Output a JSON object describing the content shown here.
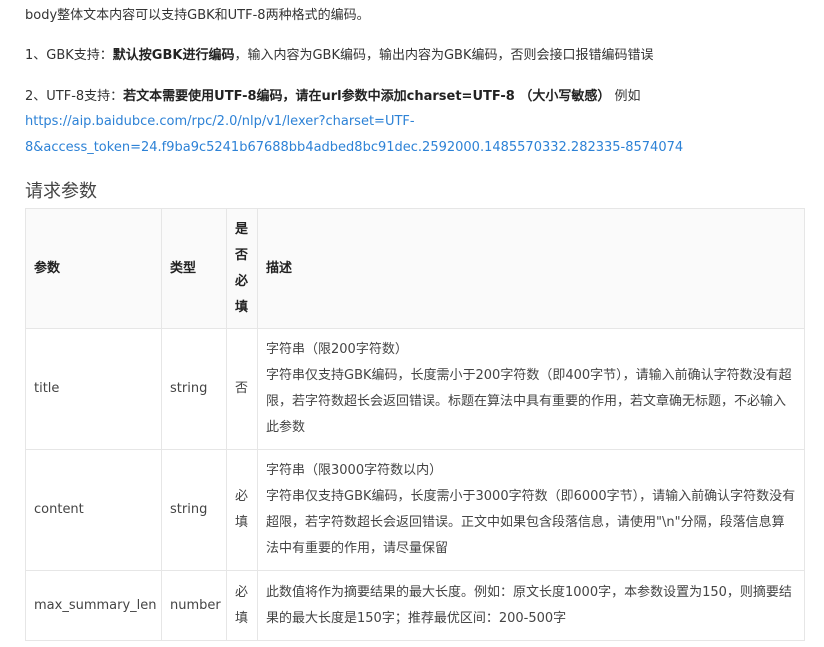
{
  "intro": {
    "encoding_note": "body整体文本内容可以支持GBK和UTF-8两种格式的编码。",
    "gbk": {
      "prefix": "1、GBK支持：",
      "bold": "默认按GBK进行编码",
      "rest": "，输入内容为GBK编码，输出内容为GBK编码，否则会接口报错编码错误"
    },
    "utf8": {
      "prefix": "2、UTF-8支持：",
      "bold": "若文本需要使用UTF-8编码，请在url参数中添加charset=UTF-8 （大小写敏感）",
      "rest": " 例如",
      "url_line1": "https://aip.baidubce.com/rpc/2.0/nlp/v1/lexer?charset=UTF-",
      "url_line2": "8&access_token=24.f9ba9c5241b67688bb4adbed8bc91dec.2592000.1485570332.282335-8574074"
    }
  },
  "section_title": "请求参数",
  "table": {
    "headers": {
      "param": "参数",
      "type": "类型",
      "required": "是否必填",
      "desc": "描述"
    },
    "rows": [
      {
        "param": "title",
        "type": "string",
        "required": "否",
        "desc_line1": "字符串（限200字符数）",
        "desc_line2": "字符串仅支持GBK编码，长度需小于200字符数（即400字节），请输入前确认字符数没有超限，若字符数超长会返回错误。标题在算法中具有重要的作用，若文章确无标题，不必输入此参数"
      },
      {
        "param": "content",
        "type": "string",
        "required": "必填",
        "desc_line1": "字符串（限3000字符数以内）",
        "desc_line2": "字符串仅支持GBK编码，长度需小于3000字符数（即6000字节），请输入前确认字符数没有超限，若字符数超长会返回错误。正文中如果包含段落信息，请使用\"\\n\"分隔，段落信息算法中有重要的作用，请尽量保留"
      },
      {
        "param": "max_summary_len",
        "type": "number",
        "required": "必填",
        "desc_line1": "此数值将作为摘要结果的最大长度。例如：原文长度1000字，本参数设置为150，则摘要结果的最大长度是150字；推荐最优区间：200-500字",
        "desc_line2": ""
      }
    ]
  }
}
